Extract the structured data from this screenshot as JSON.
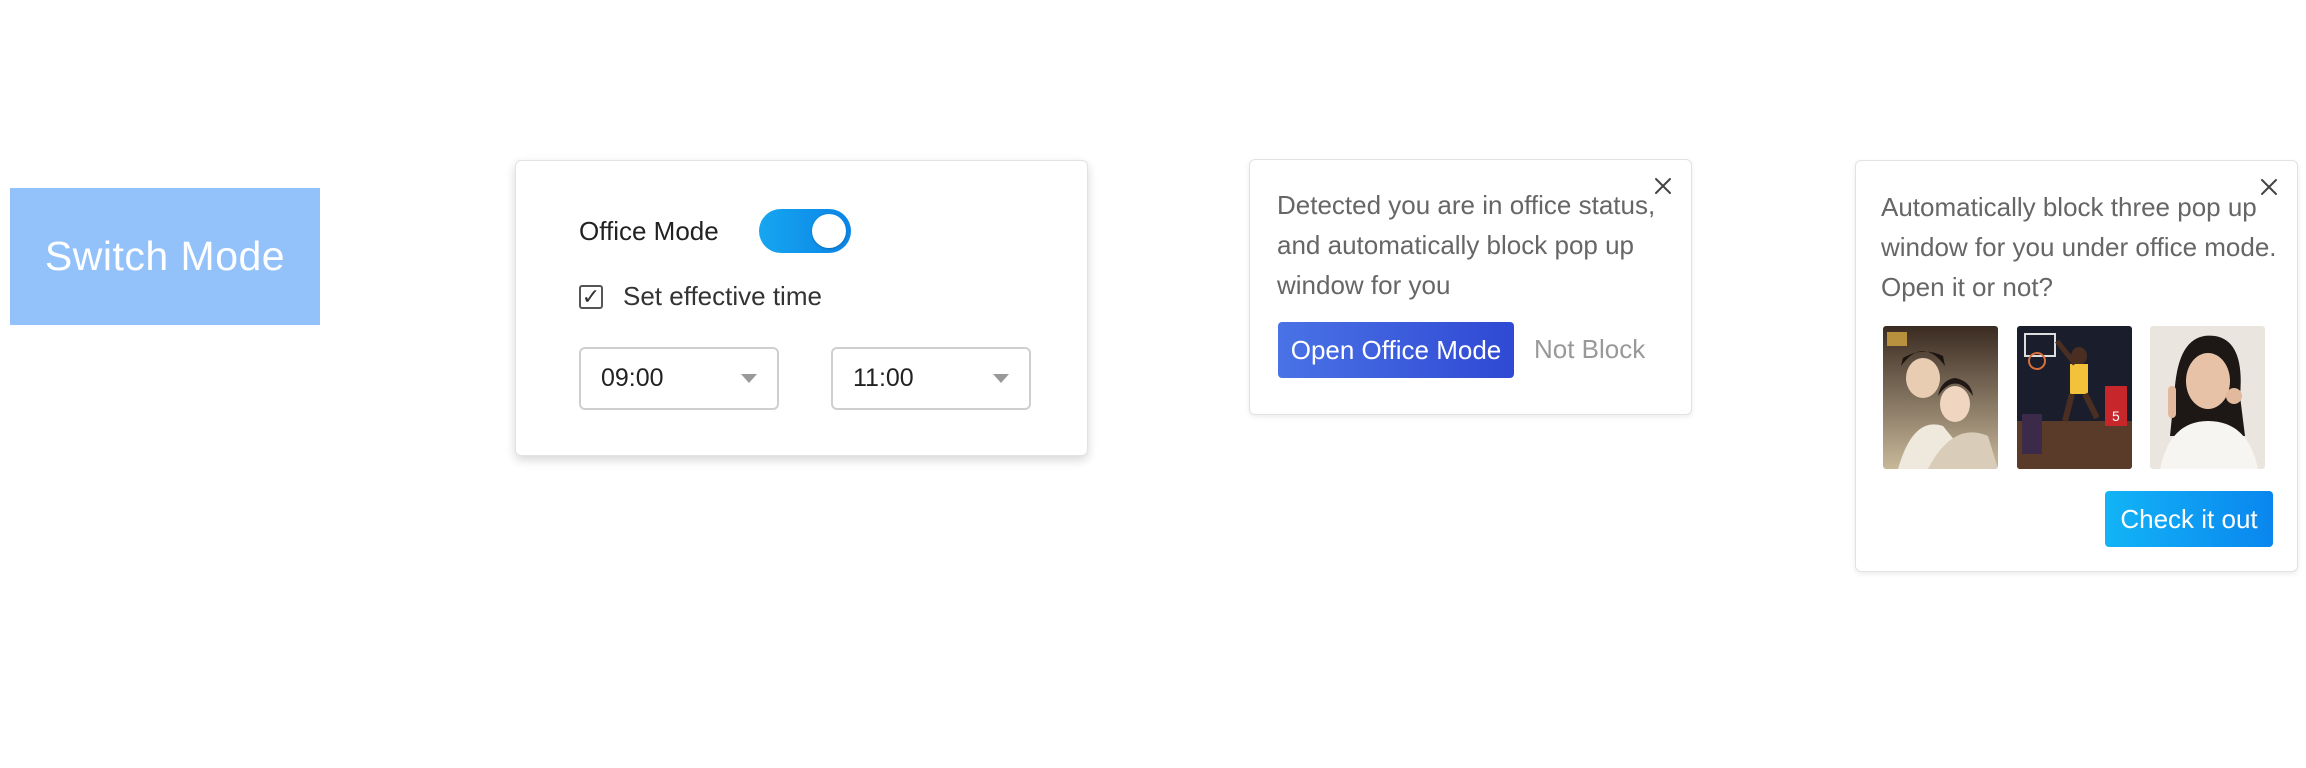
{
  "switch_mode": {
    "label": "Switch Mode"
  },
  "office_settings": {
    "mode_label": "Office Mode",
    "mode_enabled": true,
    "effective_time_label": "Set effective time",
    "effective_time_checked": true,
    "check_mark": "✓",
    "start_time": "09:00",
    "end_time": "11:00"
  },
  "detect_popup": {
    "message": "Detected you are in office status, and automatically block pop up window for you",
    "open_button": "Open Office Mode",
    "not_block_button": "Not Block"
  },
  "block_popup": {
    "message": "Automatically block three pop up window for you under office mode. Open it or not?",
    "thumbnails": [
      "drama-poster",
      "basketball-dunk",
      "woman-portrait"
    ],
    "check_button": "Check it out"
  },
  "colors": {
    "switch_button_bg": "#93c2fb",
    "toggle_on": "#0b84e6",
    "open_button": "#2f49d3",
    "check_button": "#0a86ee"
  }
}
